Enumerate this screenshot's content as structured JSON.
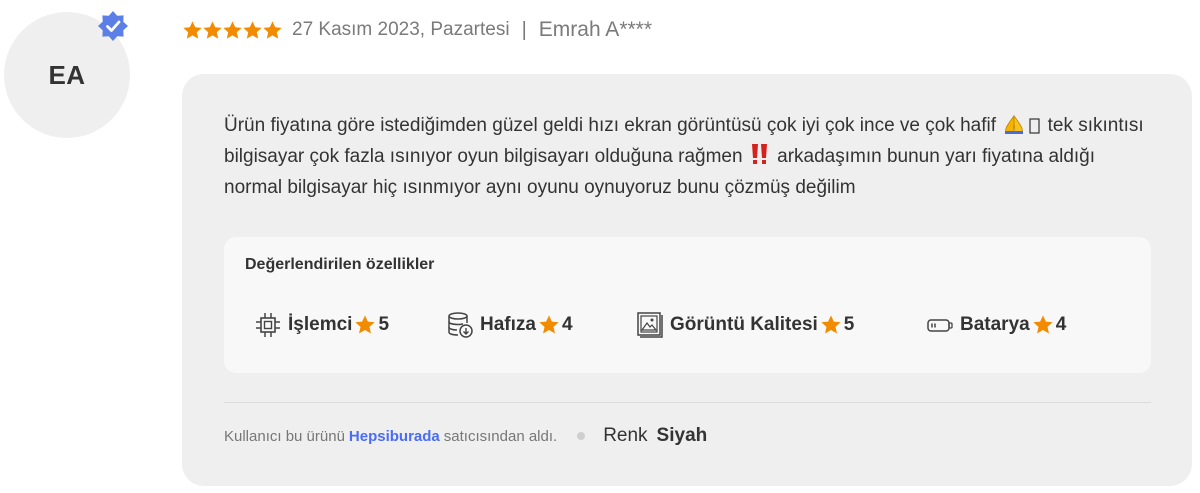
{
  "reviewer": {
    "initials": "EA",
    "name": "Emrah A****",
    "verified": true
  },
  "review": {
    "rating": 5,
    "date": "27 Kasım 2023, Pazartesi",
    "separator": "|",
    "text_part1": "Ürün fiyatına göre istediğimden güzel geldi hızı ekran görüntüsü çok iyi çok ince ve çok hafif",
    "text_part2": "tek sıkıntısı bilgisayar çok fazla ısınıyor oyun bilgisayarı olduğuna rağmen",
    "text_part3": "arkadaşımın bunun yarı fiyatına aldığı normal bilgisayar hiç ısınmıyor aynı oyunu oynuyoruz bunu çözmüş değilim"
  },
  "features": {
    "title": "Değerlendirilen özellikler",
    "items": [
      {
        "label": "İşlemci",
        "score": "5",
        "icon": "cpu-icon"
      },
      {
        "label": "Hafıza",
        "score": "4",
        "icon": "memory-icon"
      },
      {
        "label": "Görüntü Kalitesi",
        "score": "5",
        "icon": "image-icon"
      },
      {
        "label": "Batarya",
        "score": "4",
        "icon": "battery-icon"
      }
    ]
  },
  "footer": {
    "prefix": "Kullanıcı bu ürünü",
    "seller": "Hepsiburada",
    "suffix": "satıcısından aldı.",
    "color_label": "Renk",
    "color_value": "Siyah"
  },
  "colors": {
    "star": "#f28b00",
    "verified": "#5b7fe6",
    "link": "#4a6cf7",
    "card_bg": "#efefef"
  }
}
